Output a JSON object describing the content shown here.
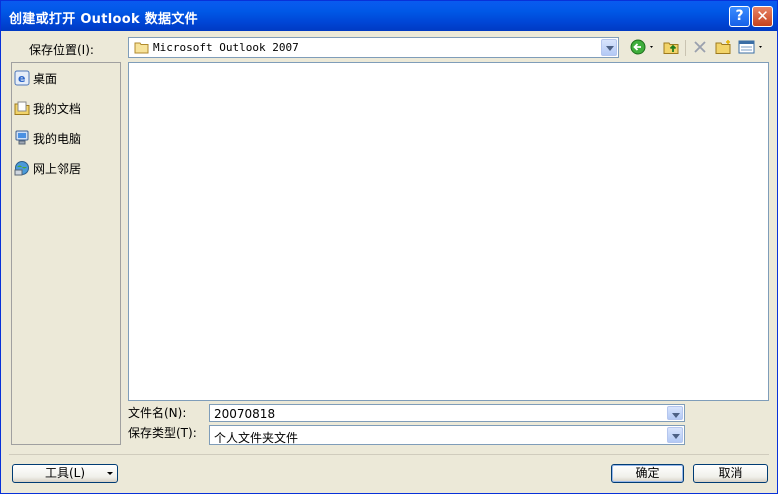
{
  "window": {
    "title": "创建或打开 Outlook 数据文件",
    "help_label": "?",
    "close_label": "✕"
  },
  "save_in": {
    "label": "保存位置(I):",
    "value": "Microsoft Outlook 2007"
  },
  "toolbar": {
    "icons": [
      "back-icon",
      "up-folder-icon",
      "delete-icon",
      "new-folder-icon",
      "views-icon"
    ]
  },
  "places": [
    {
      "label": "桌面",
      "icon": "desktop-icon"
    },
    {
      "label": "我的文档",
      "icon": "my-documents-icon"
    },
    {
      "label": "我的电脑",
      "icon": "my-computer-icon"
    },
    {
      "label": "网上邻居",
      "icon": "network-places-icon"
    }
  ],
  "filename": {
    "label": "文件名(N):",
    "value": "20070818"
  },
  "filetype": {
    "label": "保存类型(T):",
    "value": "个人文件夹文件"
  },
  "buttons": {
    "tools": "工具(L)",
    "ok": "确定",
    "cancel": "取消"
  }
}
